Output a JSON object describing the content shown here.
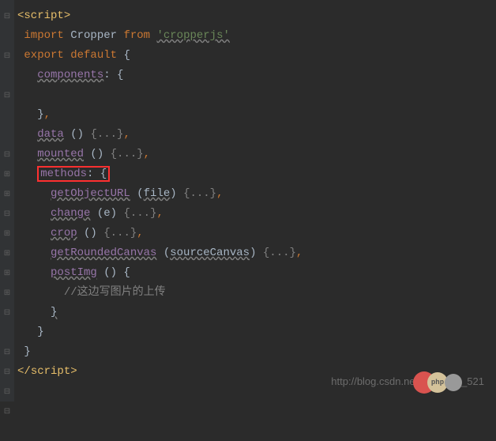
{
  "gutter": {
    "icons": [
      "⊟",
      "",
      "⊟",
      "",
      "⊟",
      "",
      "",
      "⊟",
      "⊞",
      "⊞",
      "⊟",
      "⊞",
      "⊞",
      "⊞",
      "⊞",
      "⊟",
      "",
      "⊟",
      "⊟",
      "⊟",
      "⊟",
      ""
    ]
  },
  "code": {
    "l1": {
      "open": "<",
      "tag": "script",
      "close": ">"
    },
    "l2": {
      "kw1": "import",
      "id": " Cropper ",
      "kw2": "from ",
      "str": "'cropperjs'"
    },
    "l3": {
      "kw1": "export ",
      "kw2": "default ",
      "brace": "{"
    },
    "l4": {
      "prop": "components",
      "rest": ": {"
    },
    "l5": "",
    "l6": {
      "brace": "}",
      "comma": ","
    },
    "l7": {
      "prop": "data",
      "params": " () ",
      "fold": "{...}",
      "comma": ","
    },
    "l8": {
      "prop": "mounted",
      "params": " () ",
      "fold": "{...}",
      "comma": ","
    },
    "l9": {
      "prop": "methods",
      "rest": ": {"
    },
    "l10": {
      "prop": "getObjectURL",
      "params": " (",
      "param": "file",
      "params2": ") ",
      "fold": "{...}",
      "comma": ","
    },
    "l11": {
      "prop": "change",
      "params": " (",
      "param": "e",
      "params2": ") ",
      "fold": "{...}",
      "comma": ","
    },
    "l12": {
      "prop": "crop",
      "params": " () ",
      "fold": "{...}",
      "comma": ","
    },
    "l13": {
      "prop": "getRoundedCanvas",
      "params": " (",
      "param": "sourceCanvas",
      "params2": ") ",
      "fold": "{...}",
      "comma": ","
    },
    "l14": {
      "prop": "postImg",
      "params": " () {"
    },
    "l15": {
      "comment": "//这边写图片的上传"
    },
    "l16": {
      "brace": "}"
    },
    "l17": {
      "brace": "}"
    },
    "l18": {
      "brace": "}"
    },
    "l19": {
      "open": "</",
      "tag": "script",
      "close": ">"
    }
  },
  "watermark": "http://blog.csdn.net/Jasoncol_521",
  "logo_text": "php"
}
